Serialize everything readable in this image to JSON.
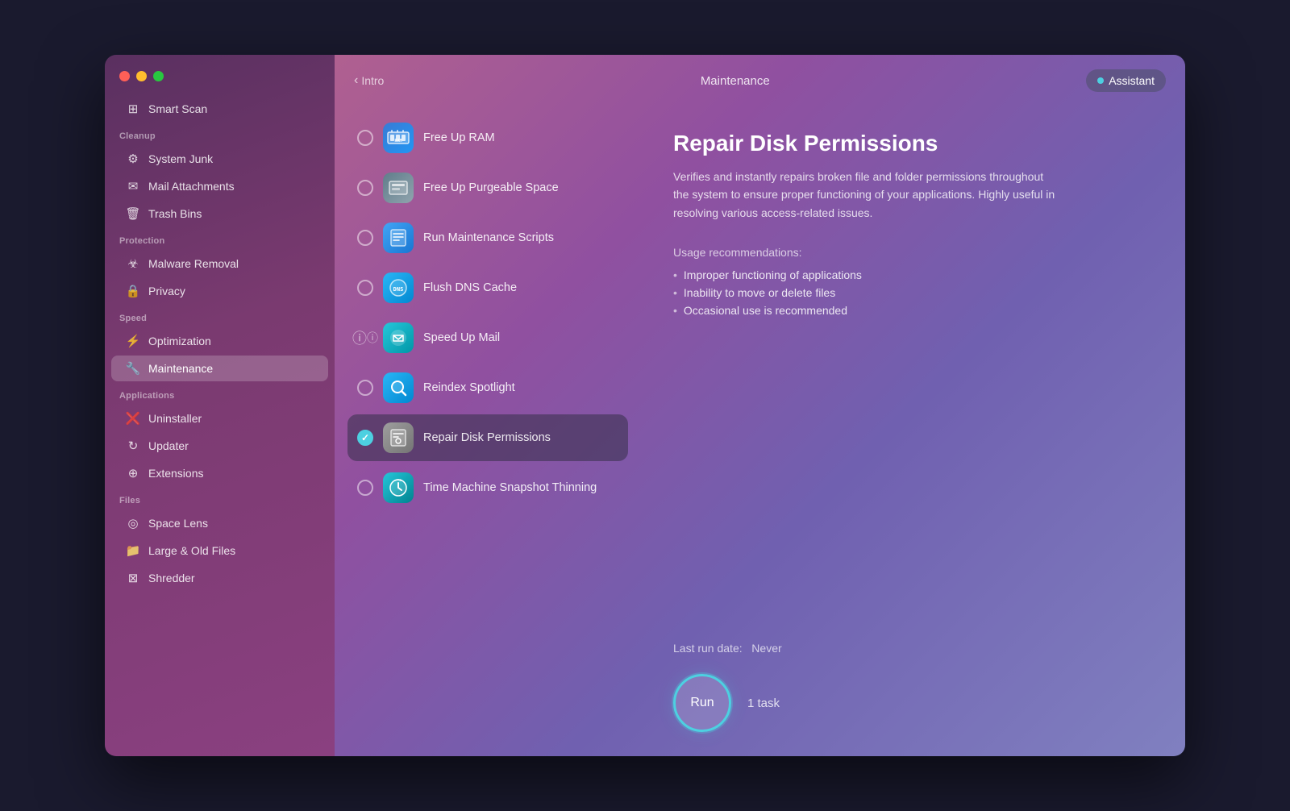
{
  "window": {
    "title": "Maintenance"
  },
  "titlebar": {
    "back_label": "Intro",
    "center_label": "Maintenance",
    "assistant_label": "Assistant"
  },
  "sidebar": {
    "smart_scan": "Smart Scan",
    "cleanup_label": "Cleanup",
    "system_junk": "System Junk",
    "mail_attachments": "Mail Attachments",
    "trash_bins": "Trash Bins",
    "protection_label": "Protection",
    "malware_removal": "Malware Removal",
    "privacy": "Privacy",
    "speed_label": "Speed",
    "optimization": "Optimization",
    "maintenance": "Maintenance",
    "applications_label": "Applications",
    "uninstaller": "Uninstaller",
    "updater": "Updater",
    "extensions": "Extensions",
    "files_label": "Files",
    "space_lens": "Space Lens",
    "large_old_files": "Large & Old Files",
    "shredder": "Shredder"
  },
  "tasks": [
    {
      "id": "free-up-ram",
      "name": "Free Up RAM",
      "icon": "ram",
      "state": "unchecked"
    },
    {
      "id": "free-up-purgeable",
      "name": "Free Up Purgeable Space",
      "icon": "space",
      "state": "unchecked"
    },
    {
      "id": "run-maintenance-scripts",
      "name": "Run Maintenance Scripts",
      "icon": "scripts",
      "state": "unchecked"
    },
    {
      "id": "flush-dns-cache",
      "name": "Flush DNS Cache",
      "icon": "dns",
      "state": "unchecked"
    },
    {
      "id": "speed-up-mail",
      "name": "Speed Up Mail",
      "icon": "mail",
      "state": "info"
    },
    {
      "id": "reindex-spotlight",
      "name": "Reindex Spotlight",
      "icon": "spotlight",
      "state": "unchecked"
    },
    {
      "id": "repair-disk-permissions",
      "name": "Repair Disk Permissions",
      "icon": "disk",
      "state": "checked",
      "selected": true
    },
    {
      "id": "time-machine-snapshot-thinning",
      "name": "Time Machine Snapshot Thinning",
      "icon": "timemachine",
      "state": "unchecked"
    }
  ],
  "detail": {
    "title": "Repair Disk Permissions",
    "description": "Verifies and instantly repairs broken file and folder permissions throughout the system to ensure proper functioning of your applications. Highly useful in resolving various access-related issues.",
    "usage_title": "Usage recommendations:",
    "usage_items": [
      "Improper functioning of applications",
      "Inability to move or delete files",
      "Occasional use is recommended"
    ],
    "last_run_label": "Last run date:",
    "last_run_value": "Never",
    "run_button_label": "Run",
    "task_count": "1 task"
  }
}
